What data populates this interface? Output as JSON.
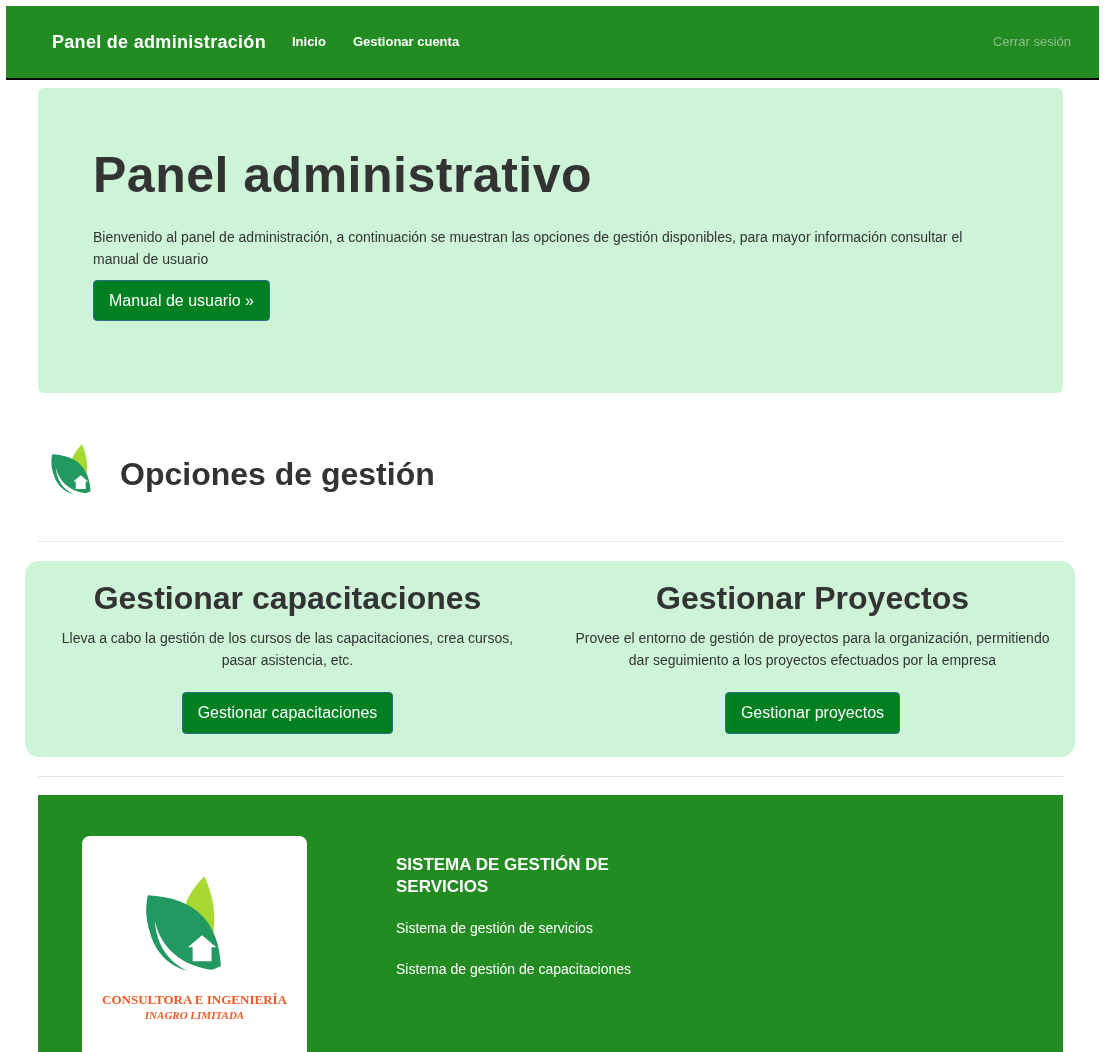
{
  "navbar": {
    "brand": "Panel de administración",
    "links": [
      {
        "label": "Inicio"
      },
      {
        "label": "Gestionar cuenta"
      }
    ],
    "logout": "Cerrar sesión"
  },
  "hero": {
    "title": "Panel administrativo",
    "text": "Bienvenido al panel de administración, a continuación se muestran las opciones de gestión disponibles, para mayor información consultar el manual de usuario",
    "button": "Manual de usuario »"
  },
  "section": {
    "title": "Opciones de gestión"
  },
  "options": [
    {
      "title": "Gestionar capacitaciones",
      "text": "Lleva a cabo la gestión de los cursos de las capacitaciones, crea cursos, pasar asistencia, etc.",
      "button": "Gestionar capacitaciones"
    },
    {
      "title": "Gestionar Proyectos",
      "text": "Provee el entorno de gestión de proyectos para la organización, permitiendo dar seguimiento a los proyectos efectuados por la empresa",
      "button": "Gestionar proyectos"
    }
  ],
  "footer": {
    "logo_lines": [
      "CONSULTORA E INGENIERÍA",
      "INAGRO LIMITADA"
    ],
    "title": "SISTEMA DE GESTIÓN DE SERVICIOS",
    "links": [
      {
        "label": "Sistema de gestión de servicios"
      },
      {
        "label": "Sistema de gestión de capacitaciones"
      }
    ]
  }
}
